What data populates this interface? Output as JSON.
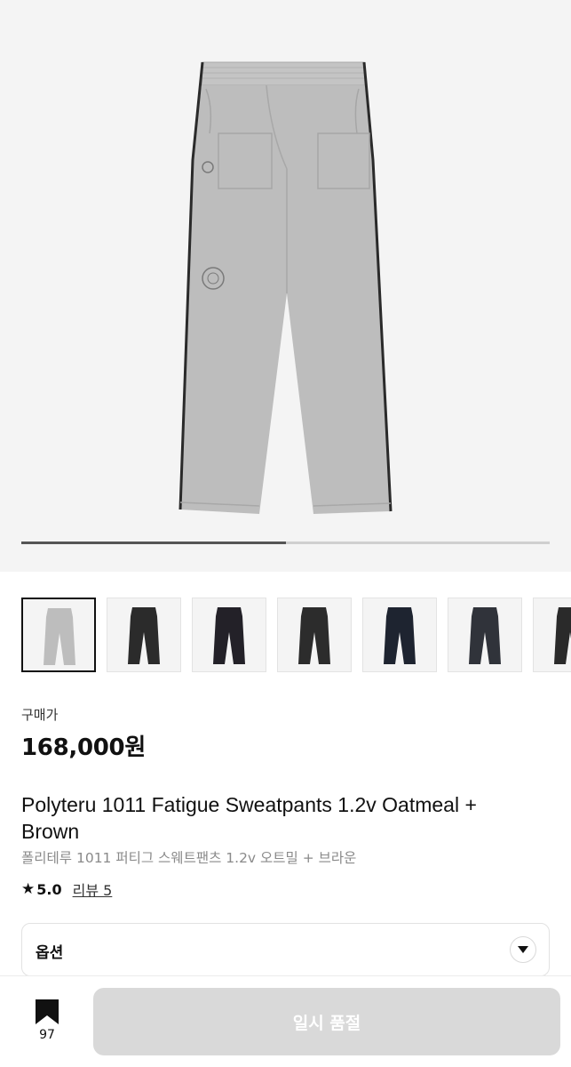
{
  "gallery": {
    "progress": 0.5,
    "thumbnails": [
      {
        "name": "thumb-oatmeal",
        "color": "#bdbdbd"
      },
      {
        "name": "thumb-charcoal",
        "color": "#2b2b2b"
      },
      {
        "name": "thumb-black-purple",
        "color": "#232128"
      },
      {
        "name": "thumb-black",
        "color": "#2c2c2c"
      },
      {
        "name": "thumb-navy",
        "color": "#1e2430"
      },
      {
        "name": "thumb-dark-gray",
        "color": "#30333a"
      },
      {
        "name": "thumb-partial",
        "color": "#2a2a2a"
      }
    ]
  },
  "product": {
    "price_label": "구매가",
    "price": "168,000원",
    "title_en": "Polyteru 1011 Fatigue Sweatpants 1.2v Oatmeal + Brown",
    "title_ko": "폴리테루 1011 퍼티그 스웨트팬츠 1.2v 오트밀 + 브라운",
    "rating_star": "★",
    "rating_score": "5.0",
    "review_link": "리뷰 5"
  },
  "options": {
    "label": "옵션",
    "chevron_icon": "chevron-down-icon"
  },
  "bottom_bar": {
    "bookmark_icon": "bookmark-icon",
    "bookmark_count": "97",
    "purchase_button": "일시 품절"
  },
  "colors": {
    "pants_main": "#bdbdbd",
    "piping": "#2a2a2a",
    "disabled_button": "#d9d9d9"
  }
}
